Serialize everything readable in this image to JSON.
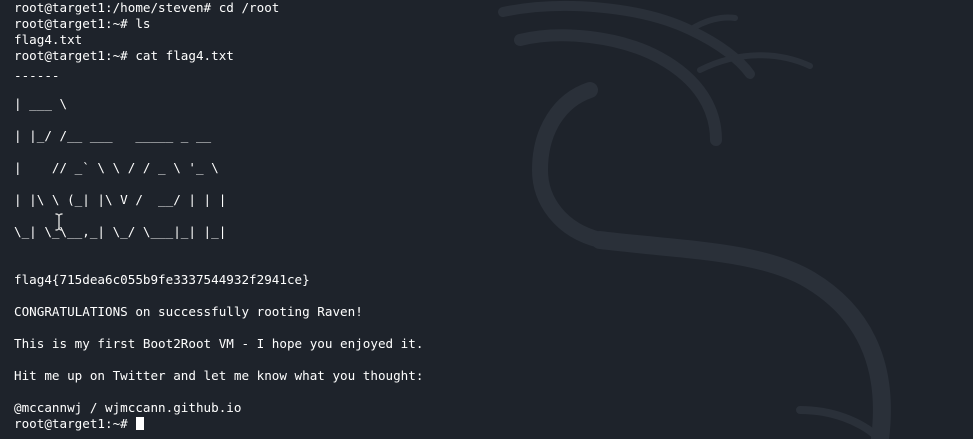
{
  "colors": {
    "background": "#1e232b",
    "text": "#ffffff",
    "wallpaper_accent": "#2b323b"
  },
  "terminal": {
    "prompt_cd": "root@target1:/home/steven# cd /root",
    "prompt_ls": "root@target1:~# ls",
    "ls_output": "flag4.txt",
    "prompt_cat": "root@target1:~# cat flag4.txt",
    "ascii_art": [
      "------",
      "| ___ \\",
      "| |_/ /__ ___   _____ _ __",
      "|    // _` \\ \\ / / _ \\ '_ \\",
      "| |\\ \\ (_| |\\ V /  __/ | | |",
      "\\_| \\_\\__,_| \\_/ \\___|_| |_|"
    ],
    "flag": "flag4{715dea6c055b9fe3337544932f2941ce}",
    "congrats": "CONGRATULATIONS on successfully rooting Raven!",
    "first_vm": "This is my first Boot2Root VM - I hope you enjoyed it.",
    "twitter": "Hit me up on Twitter and let me know what you thought:",
    "handle": "@mccannwj / wjmccann.github.io",
    "final_prompt": "root@target1:~# "
  },
  "icons": {
    "wallpaper": "kali-dragon-logo",
    "mouse_cursor": "text-ibeam-cursor"
  }
}
